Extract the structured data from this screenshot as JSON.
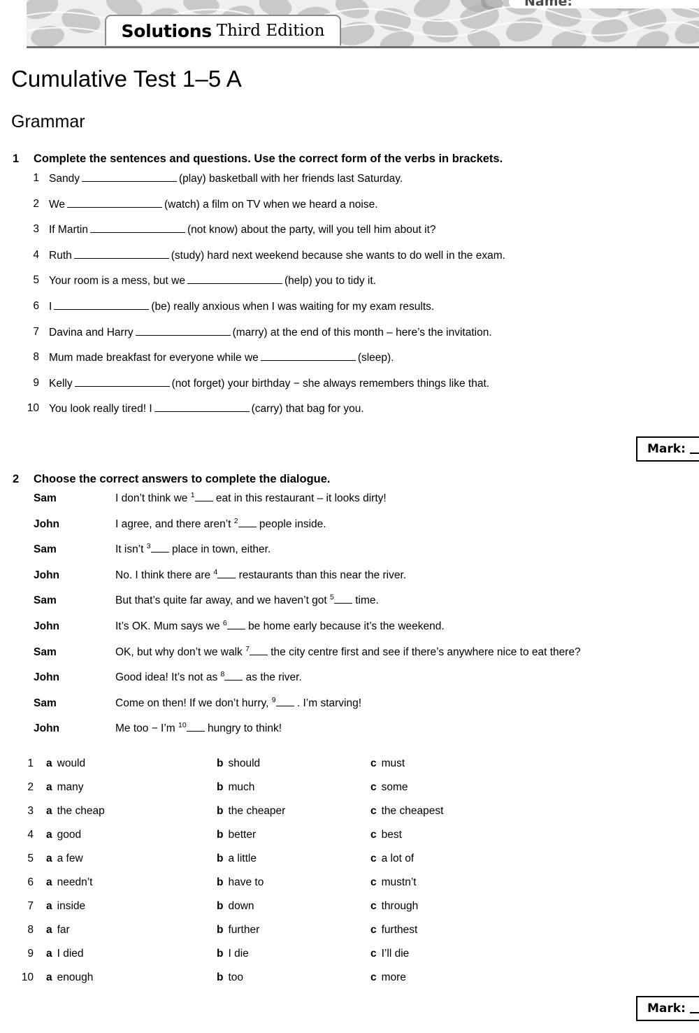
{
  "header": {
    "logo_brand": "Solutions",
    "logo_edition": "Third Edition",
    "name_label": "Name:"
  },
  "page_title": "Cumulative Test 1–5 A",
  "section_title": "Grammar",
  "exercises": [
    {
      "number": "1",
      "instruction": "Complete the sentences and questions. Use the correct form of the verbs in brackets.",
      "questions": [
        {
          "num": "1",
          "before": "Sandy",
          "after": "(play) basketball with her friends last Saturday."
        },
        {
          "num": "2",
          "before": "We",
          "after": "(watch) a film on TV when we heard a noise."
        },
        {
          "num": "3",
          "before": "If Martin",
          "after": "(not know) about the party, will you tell him about it?"
        },
        {
          "num": "4",
          "before": "Ruth",
          "after": "(study) hard next weekend because she wants to do well in the exam."
        },
        {
          "num": "5",
          "before": "Your room is a mess, but we",
          "after": "(help) you to tidy it."
        },
        {
          "num": "6",
          "before": "I",
          "after": "(be) really anxious when I was waiting for my exam results."
        },
        {
          "num": "7",
          "before": "Davina and Harry",
          "after": "(marry) at the end of this month – here’s the invitation."
        },
        {
          "num": "8",
          "before": "Mum made breakfast for everyone while we",
          "after": "(sleep)."
        },
        {
          "num": "9",
          "before": "Kelly",
          "after": "(not forget) your birthday − she always remembers things like that."
        },
        {
          "num": "10",
          "before": "You look really tired! I",
          "after": "(carry) that bag for you."
        }
      ],
      "mark_label": "Mark:"
    },
    {
      "number": "2",
      "instruction": "Choose the correct answers to complete the dialogue.",
      "dialogue": [
        {
          "speaker": "Sam",
          "before": "I don’t think we",
          "sup": "1",
          "after": "eat in this restaurant – it looks dirty!"
        },
        {
          "speaker": "John",
          "before": "I agree, and there aren’t",
          "sup": "2",
          "after": "people inside."
        },
        {
          "speaker": "Sam",
          "before": "It isn’t",
          "sup": "3",
          "after": "place in town, either."
        },
        {
          "speaker": "John",
          "before": "No. I think there are",
          "sup": "4",
          "after": "restaurants than this near the river."
        },
        {
          "speaker": "Sam",
          "before": "But that’s quite far away, and we haven’t got",
          "sup": "5",
          "after": "time."
        },
        {
          "speaker": "John",
          "before": "It’s OK. Mum says we",
          "sup": "6",
          "after": "be home early because it’s the weekend."
        },
        {
          "speaker": "Sam",
          "before": "OK, but why don’t we walk",
          "sup": "7",
          "after": "the city centre first and see if there’s anywhere nice to eat there?"
        },
        {
          "speaker": "John",
          "before": "Good idea! It’s not as",
          "sup": "8",
          "after": "as the river."
        },
        {
          "speaker": "Sam",
          "before": "Come on then! If we don’t hurry,",
          "sup": "9",
          "after": ". I’m starving!"
        },
        {
          "speaker": "John",
          "before": "Me too − I’m",
          "sup": "10",
          "after": "hungry to think!"
        }
      ],
      "options": [
        {
          "num": "1",
          "a": "would",
          "b": "should",
          "c": "must"
        },
        {
          "num": "2",
          "a": "many",
          "b": "much",
          "c": "some"
        },
        {
          "num": "3",
          "a": "the cheap",
          "b": "the cheaper",
          "c": "the cheapest"
        },
        {
          "num": "4",
          "a": "good",
          "b": "better",
          "c": "best"
        },
        {
          "num": "5",
          "a": "a few",
          "b": "a little",
          "c": "a lot of"
        },
        {
          "num": "6",
          "a": "needn’t",
          "b": "have to",
          "c": "mustn’t"
        },
        {
          "num": "7",
          "a": "inside",
          "b": "down",
          "c": "through"
        },
        {
          "num": "8",
          "a": "far",
          "b": "further",
          "c": "furthest"
        },
        {
          "num": "9",
          "a": "I died",
          "b": "I die",
          "c": "I’ll die"
        },
        {
          "num": "10",
          "a": "enough",
          "b": "too",
          "c": "more"
        }
      ],
      "option_letters": {
        "a": "a",
        "b": "b",
        "c": "c"
      },
      "mark_label": "Mark:"
    }
  ]
}
